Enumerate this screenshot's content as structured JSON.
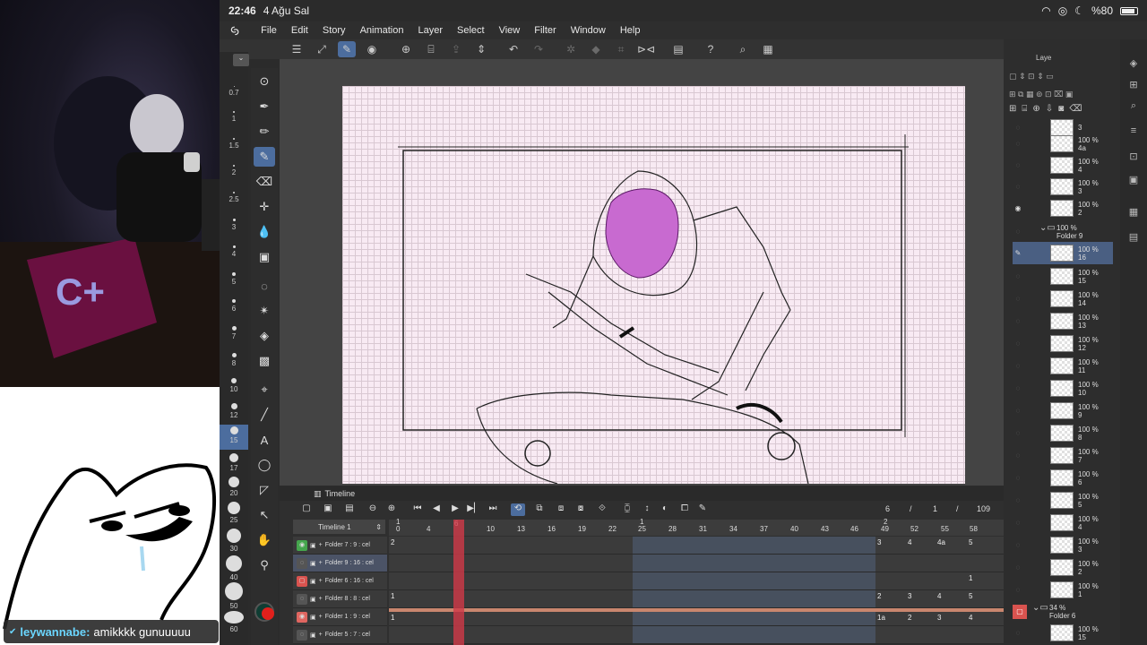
{
  "status": {
    "time": "22:46",
    "date": "4 Ağu Sal",
    "battery": "%80"
  },
  "chat": {
    "user": "leywannabe:",
    "message": "amikkkk gunuuuuu"
  },
  "menu": [
    "File",
    "Edit",
    "Story",
    "Animation",
    "Layer",
    "Select",
    "View",
    "Filter",
    "Window",
    "Help"
  ],
  "brush_sizes": [
    "0.7",
    "1",
    "1.5",
    "2",
    "2.5",
    "3",
    "4",
    "5",
    "6",
    "7",
    "8",
    "10",
    "12",
    "15",
    "17",
    "20",
    "25",
    "30",
    "40",
    "50",
    "60"
  ],
  "timeline": {
    "title": "Timeline",
    "name": "Timeline 1",
    "frame_current": "6",
    "frame_sep": "/",
    "frame_one": "1",
    "frame_total": "109",
    "ruler": [
      "0",
      "4",
      "6",
      "10",
      "13",
      "16",
      "19",
      "22",
      "25",
      "28",
      "31",
      "34",
      "37",
      "40",
      "43",
      "46",
      "49",
      "52",
      "55",
      "58"
    ],
    "ruler_top": [
      "1",
      "1",
      "2"
    ],
    "tracks": [
      {
        "label": "Folder 7 : 9 : cel",
        "cels": [
          "2",
          "3",
          "4",
          "4a",
          "5"
        ]
      },
      {
        "label": "Folder 9 : 16 : cel",
        "cels": []
      },
      {
        "label": "Folder 6 : 16 : cel",
        "cels": [
          "1"
        ]
      },
      {
        "label": "Folder 8 : 8 : cel",
        "cels": [
          "1",
          "2",
          "3",
          "4",
          "5"
        ]
      },
      {
        "label": "Folder 1 : 9 : cel",
        "cels": [
          "1",
          "1a",
          "2",
          "3",
          "4"
        ]
      },
      {
        "label": "Folder 5 : 7 : cel",
        "cels": []
      }
    ]
  },
  "layers": {
    "tab": "Laye",
    "items": [
      {
        "opacity": "",
        "name": "3",
        "type": "layer"
      },
      {
        "opacity": "100 %",
        "name": "4a",
        "type": "layer"
      },
      {
        "opacity": "100 %",
        "name": "4",
        "type": "layer"
      },
      {
        "opacity": "100 %",
        "name": "3",
        "type": "layer"
      },
      {
        "opacity": "100 %",
        "name": "2",
        "type": "layer"
      },
      {
        "opacity": "100 %",
        "name": "Folder 9",
        "type": "folder"
      },
      {
        "opacity": "100 %",
        "name": "16",
        "type": "selected"
      },
      {
        "opacity": "100 %",
        "name": "15",
        "type": "layer"
      },
      {
        "opacity": "100 %",
        "name": "14",
        "type": "layer"
      },
      {
        "opacity": "100 %",
        "name": "13",
        "type": "layer"
      },
      {
        "opacity": "100 %",
        "name": "12",
        "type": "layer"
      },
      {
        "opacity": "100 %",
        "name": "11",
        "type": "layer"
      },
      {
        "opacity": "100 %",
        "name": "10",
        "type": "layer"
      },
      {
        "opacity": "100 %",
        "name": "9",
        "type": "layer"
      },
      {
        "opacity": "100 %",
        "name": "8",
        "type": "layer"
      },
      {
        "opacity": "100 %",
        "name": "7",
        "type": "layer"
      },
      {
        "opacity": "100 %",
        "name": "6",
        "type": "layer"
      },
      {
        "opacity": "100 %",
        "name": "5",
        "type": "layer"
      },
      {
        "opacity": "100 %",
        "name": "4",
        "type": "layer"
      },
      {
        "opacity": "100 %",
        "name": "3",
        "type": "layer"
      },
      {
        "opacity": "100 %",
        "name": "2",
        "type": "layer"
      },
      {
        "opacity": "100 %",
        "name": "1",
        "type": "layer"
      },
      {
        "opacity": "34 %",
        "name": "Folder 6",
        "type": "folder"
      },
      {
        "opacity": "100 %",
        "name": "15",
        "type": "layer"
      }
    ]
  }
}
